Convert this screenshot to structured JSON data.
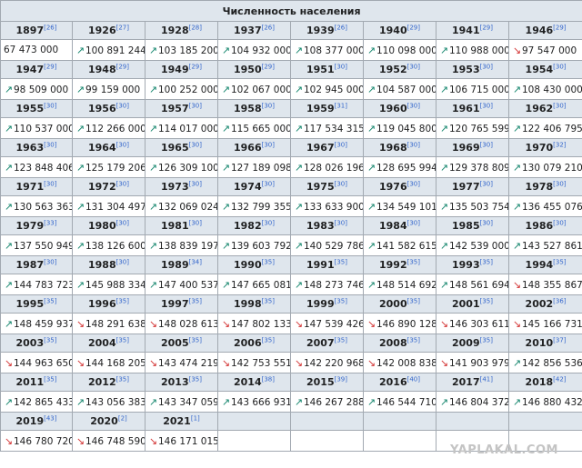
{
  "table": {
    "caption": "Численность населения",
    "up_arrow": "↗",
    "down_arrow": "↘",
    "rows": [
      [
        {
          "year": "1897",
          "ref": "[26]",
          "value": "67 473 000",
          "trend": "none"
        },
        {
          "year": "1926",
          "ref": "[27]",
          "value": "100 891 244",
          "trend": "up"
        },
        {
          "year": "1928",
          "ref": "[28]",
          "value": "103 185 200",
          "trend": "up"
        },
        {
          "year": "1937",
          "ref": "[26]",
          "value": "104 932 000",
          "trend": "up"
        },
        {
          "year": "1939",
          "ref": "[26]",
          "value": "108 377 000",
          "trend": "up"
        },
        {
          "year": "1940",
          "ref": "[29]",
          "value": "110 098 000",
          "trend": "up"
        },
        {
          "year": "1941",
          "ref": "[29]",
          "value": "110 988 000",
          "trend": "up"
        },
        {
          "year": "1946",
          "ref": "[29]",
          "value": "97 547 000",
          "trend": "down"
        }
      ],
      [
        {
          "year": "1947",
          "ref": "[29]",
          "value": "98 509 000",
          "trend": "up"
        },
        {
          "year": "1948",
          "ref": "[29]",
          "value": "99 159 000",
          "trend": "up"
        },
        {
          "year": "1949",
          "ref": "[29]",
          "value": "100 252 000",
          "trend": "up"
        },
        {
          "year": "1950",
          "ref": "[29]",
          "value": "102 067 000",
          "trend": "up"
        },
        {
          "year": "1951",
          "ref": "[30]",
          "value": "102 945 000",
          "trend": "up"
        },
        {
          "year": "1952",
          "ref": "[30]",
          "value": "104 587 000",
          "trend": "up"
        },
        {
          "year": "1953",
          "ref": "[30]",
          "value": "106 715 000",
          "trend": "up"
        },
        {
          "year": "1954",
          "ref": "[30]",
          "value": "108 430 000",
          "trend": "up"
        }
      ],
      [
        {
          "year": "1955",
          "ref": "[30]",
          "value": "110 537 000",
          "trend": "up"
        },
        {
          "year": "1956",
          "ref": "[30]",
          "value": "112 266 000",
          "trend": "up"
        },
        {
          "year": "1957",
          "ref": "[30]",
          "value": "114 017 000",
          "trend": "up"
        },
        {
          "year": "1958",
          "ref": "[30]",
          "value": "115 665 000",
          "trend": "up"
        },
        {
          "year": "1959",
          "ref": "[31]",
          "value": "117 534 315",
          "trend": "up"
        },
        {
          "year": "1960",
          "ref": "[30]",
          "value": "119 045 800",
          "trend": "up"
        },
        {
          "year": "1961",
          "ref": "[30]",
          "value": "120 765 599",
          "trend": "up"
        },
        {
          "year": "1962",
          "ref": "[30]",
          "value": "122 406 795",
          "trend": "up"
        }
      ],
      [
        {
          "year": "1963",
          "ref": "[30]",
          "value": "123 848 406",
          "trend": "up"
        },
        {
          "year": "1964",
          "ref": "[30]",
          "value": "125 179 206",
          "trend": "up"
        },
        {
          "year": "1965",
          "ref": "[30]",
          "value": "126 309 100",
          "trend": "up"
        },
        {
          "year": "1966",
          "ref": "[30]",
          "value": "127 189 098",
          "trend": "up"
        },
        {
          "year": "1967",
          "ref": "[30]",
          "value": "128 026 196",
          "trend": "up"
        },
        {
          "year": "1968",
          "ref": "[30]",
          "value": "128 695 994",
          "trend": "up"
        },
        {
          "year": "1969",
          "ref": "[30]",
          "value": "129 378 809",
          "trend": "up"
        },
        {
          "year": "1970",
          "ref": "[32]",
          "value": "130 079 210",
          "trend": "up"
        }
      ],
      [
        {
          "year": "1971",
          "ref": "[30]",
          "value": "130 563 363",
          "trend": "up"
        },
        {
          "year": "1972",
          "ref": "[30]",
          "value": "131 304 497",
          "trend": "up"
        },
        {
          "year": "1973",
          "ref": "[30]",
          "value": "132 069 024",
          "trend": "up"
        },
        {
          "year": "1974",
          "ref": "[30]",
          "value": "132 799 355",
          "trend": "up"
        },
        {
          "year": "1975",
          "ref": "[30]",
          "value": "133 633 900",
          "trend": "up"
        },
        {
          "year": "1976",
          "ref": "[30]",
          "value": "134 549 101",
          "trend": "up"
        },
        {
          "year": "1977",
          "ref": "[30]",
          "value": "135 503 754",
          "trend": "up"
        },
        {
          "year": "1978",
          "ref": "[30]",
          "value": "136 455 076",
          "trend": "up"
        }
      ],
      [
        {
          "year": "1979",
          "ref": "[33]",
          "value": "137 550 949",
          "trend": "up"
        },
        {
          "year": "1980",
          "ref": "[30]",
          "value": "138 126 600",
          "trend": "up"
        },
        {
          "year": "1981",
          "ref": "[30]",
          "value": "138 839 197",
          "trend": "up"
        },
        {
          "year": "1982",
          "ref": "[30]",
          "value": "139 603 792",
          "trend": "up"
        },
        {
          "year": "1983",
          "ref": "[30]",
          "value": "140 529 786",
          "trend": "up"
        },
        {
          "year": "1984",
          "ref": "[30]",
          "value": "141 582 615",
          "trend": "up"
        },
        {
          "year": "1985",
          "ref": "[30]",
          "value": "142 539 000",
          "trend": "up"
        },
        {
          "year": "1986",
          "ref": "[30]",
          "value": "143 527 861",
          "trend": "up"
        }
      ],
      [
        {
          "year": "1987",
          "ref": "[30]",
          "value": "144 783 723",
          "trend": "up"
        },
        {
          "year": "1988",
          "ref": "[30]",
          "value": "145 988 334",
          "trend": "up"
        },
        {
          "year": "1989",
          "ref": "[34]",
          "value": "147 400 537",
          "trend": "up"
        },
        {
          "year": "1990",
          "ref": "[35]",
          "value": "147 665 081",
          "trend": "up"
        },
        {
          "year": "1991",
          "ref": "[35]",
          "value": "148 273 746",
          "trend": "up"
        },
        {
          "year": "1992",
          "ref": "[35]",
          "value": "148 514 692",
          "trend": "up"
        },
        {
          "year": "1993",
          "ref": "[35]",
          "value": "148 561 694",
          "trend": "up"
        },
        {
          "year": "1994",
          "ref": "[35]",
          "value": "148 355 867",
          "trend": "down"
        }
      ],
      [
        {
          "year": "1995",
          "ref": "[35]",
          "value": "148 459 937",
          "trend": "up"
        },
        {
          "year": "1996",
          "ref": "[35]",
          "value": "148 291 638",
          "trend": "down"
        },
        {
          "year": "1997",
          "ref": "[35]",
          "value": "148 028 613",
          "trend": "down"
        },
        {
          "year": "1998",
          "ref": "[35]",
          "value": "147 802 133",
          "trend": "down"
        },
        {
          "year": "1999",
          "ref": "[35]",
          "value": "147 539 426",
          "trend": "down"
        },
        {
          "year": "2000",
          "ref": "[35]",
          "value": "146 890 128",
          "trend": "down"
        },
        {
          "year": "2001",
          "ref": "[35]",
          "value": "146 303 611",
          "trend": "down"
        },
        {
          "year": "2002",
          "ref": "[36]",
          "value": "145 166 731",
          "trend": "down"
        }
      ],
      [
        {
          "year": "2003",
          "ref": "[35]",
          "value": "144 963 650",
          "trend": "down"
        },
        {
          "year": "2004",
          "ref": "[35]",
          "value": "144 168 205",
          "trend": "down"
        },
        {
          "year": "2005",
          "ref": "[35]",
          "value": "143 474 219",
          "trend": "down"
        },
        {
          "year": "2006",
          "ref": "[35]",
          "value": "142 753 551",
          "trend": "down"
        },
        {
          "year": "2007",
          "ref": "[35]",
          "value": "142 220 968",
          "trend": "down"
        },
        {
          "year": "2008",
          "ref": "[35]",
          "value": "142 008 838",
          "trend": "down"
        },
        {
          "year": "2009",
          "ref": "[35]",
          "value": "141 903 979",
          "trend": "down"
        },
        {
          "year": "2010",
          "ref": "[37]",
          "value": "142 856 536",
          "trend": "up"
        }
      ],
      [
        {
          "year": "2011",
          "ref": "[35]",
          "value": "142 865 433",
          "trend": "up"
        },
        {
          "year": "2012",
          "ref": "[35]",
          "value": "143 056 383",
          "trend": "up"
        },
        {
          "year": "2013",
          "ref": "[35]",
          "value": "143 347 059",
          "trend": "up"
        },
        {
          "year": "2014",
          "ref": "[38]",
          "value": "143 666 931",
          "trend": "up"
        },
        {
          "year": "2015",
          "ref": "[39]",
          "value": "146 267 288",
          "trend": "up"
        },
        {
          "year": "2016",
          "ref": "[40]",
          "value": "146 544 710",
          "trend": "up"
        },
        {
          "year": "2017",
          "ref": "[41]",
          "value": "146 804 372",
          "trend": "up"
        },
        {
          "year": "2018",
          "ref": "[42]",
          "value": "146 880 432",
          "trend": "up"
        }
      ],
      [
        {
          "year": "2019",
          "ref": "[43]",
          "value": "146 780 720",
          "trend": "down"
        },
        {
          "year": "2020",
          "ref": "[2]",
          "value": "146 748 590",
          "trend": "down"
        },
        {
          "year": "2021",
          "ref": "[1]",
          "value": "146 171 015",
          "trend": "down"
        }
      ]
    ]
  },
  "watermark": "YAPLAKAL.COM"
}
